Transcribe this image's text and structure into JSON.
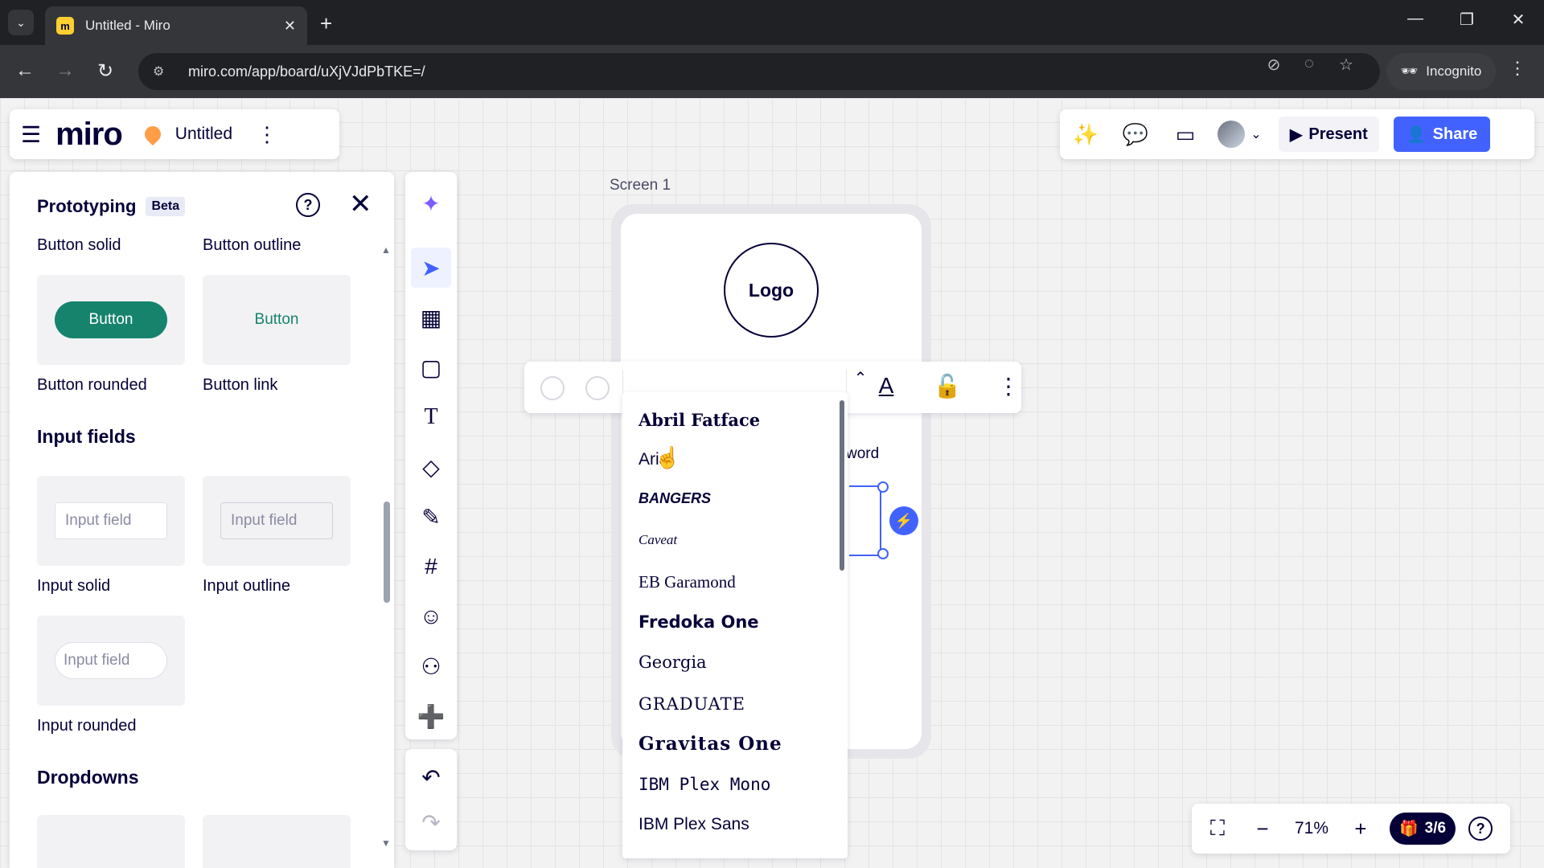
{
  "browser": {
    "tab_title": "Untitled - Miro",
    "url": "miro.com/app/board/uXjVJdPbTKE=/",
    "incognito_label": "Incognito"
  },
  "boardbar": {
    "logo": "miro",
    "board_title": "Untitled"
  },
  "topright": {
    "present_label": "Present",
    "share_label": "Share"
  },
  "panel": {
    "title": "Prototyping",
    "badge": "Beta",
    "top_labels": [
      "Button solid",
      "Button outline"
    ],
    "button_tile_labels": [
      "Button",
      "Button"
    ],
    "button_captions": [
      "Button rounded",
      "Button link"
    ],
    "section_inputs": "Input fields",
    "input_placeholders": [
      "Input field",
      "Input field",
      "Input field"
    ],
    "input_captions": [
      "Input solid",
      "Input outline",
      "Input rounded"
    ],
    "section_dropdowns": "Dropdowns"
  },
  "canvas": {
    "frame_label": "Screen 1",
    "logo_text": "Logo",
    "word_fragment": "word"
  },
  "fonts": [
    "Abril Fatface",
    "Arial",
    "BANGERS",
    "Caveat",
    "EB Garamond",
    "Fredoka One",
    "Georgia",
    "GRADUATE",
    "Gravitas One",
    "IBM Plex Mono",
    "IBM Plex Sans"
  ],
  "zoom": {
    "level": "71%",
    "pages": "3/6"
  },
  "colors": {
    "accent": "#4262ff",
    "button_green": "#16836c",
    "miro_yellow": "#ffd02f"
  }
}
